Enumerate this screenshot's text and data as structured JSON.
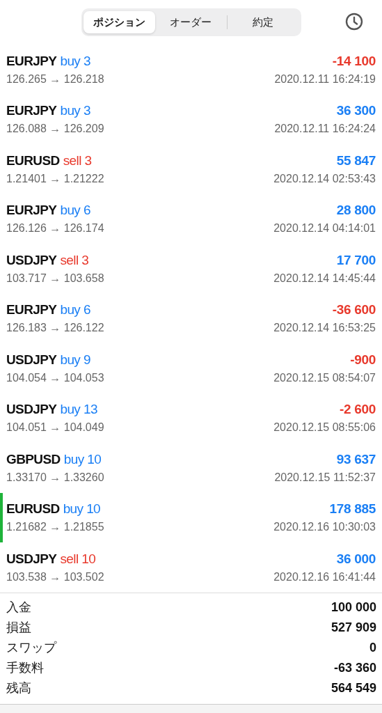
{
  "tabs": [
    {
      "label": "ポジション",
      "selected": true
    },
    {
      "label": "オーダー",
      "selected": false
    },
    {
      "label": "約定",
      "selected": false
    }
  ],
  "positions": [
    {
      "symbol": "EURJPY",
      "order": {
        "text": "buy 3",
        "color": "#1a7ff5"
      },
      "profit": {
        "text": "-14 100",
        "color": "#e8392c"
      },
      "prices": "126.265 → 126.218",
      "time": "2020.12.11 16:24:19",
      "selected": false
    },
    {
      "symbol": "EURJPY",
      "order": {
        "text": "buy 3",
        "color": "#1a7ff5"
      },
      "profit": {
        "text": "36 300",
        "color": "#1a7ff5"
      },
      "prices": "126.088 → 126.209",
      "time": "2020.12.11 16:24:24",
      "selected": false
    },
    {
      "symbol": "EURUSD",
      "order": {
        "text": "sell 3",
        "color": "#e8392c"
      },
      "profit": {
        "text": "55 847",
        "color": "#1a7ff5"
      },
      "prices": "1.21401 → 1.21222",
      "time": "2020.12.14 02:53:43",
      "selected": false
    },
    {
      "symbol": "EURJPY",
      "order": {
        "text": "buy 6",
        "color": "#1a7ff5"
      },
      "profit": {
        "text": "28 800",
        "color": "#1a7ff5"
      },
      "prices": "126.126 → 126.174",
      "time": "2020.12.14 04:14:01",
      "selected": false
    },
    {
      "symbol": "USDJPY",
      "order": {
        "text": "sell 3",
        "color": "#e8392c"
      },
      "profit": {
        "text": "17 700",
        "color": "#1a7ff5"
      },
      "prices": "103.717 → 103.658",
      "time": "2020.12.14 14:45:44",
      "selected": false
    },
    {
      "symbol": "EURJPY",
      "order": {
        "text": "buy 6",
        "color": "#1a7ff5"
      },
      "profit": {
        "text": "-36 600",
        "color": "#e8392c"
      },
      "prices": "126.183 → 126.122",
      "time": "2020.12.14 16:53:25",
      "selected": false
    },
    {
      "symbol": "USDJPY",
      "order": {
        "text": "buy 9",
        "color": "#1a7ff5"
      },
      "profit": {
        "text": "-900",
        "color": "#e8392c"
      },
      "prices": "104.054 → 104.053",
      "time": "2020.12.15 08:54:07",
      "selected": false
    },
    {
      "symbol": "USDJPY",
      "order": {
        "text": "buy 13",
        "color": "#1a7ff5"
      },
      "profit": {
        "text": "-2 600",
        "color": "#e8392c"
      },
      "prices": "104.051 → 104.049",
      "time": "2020.12.15 08:55:06",
      "selected": false
    },
    {
      "symbol": "GBPUSD",
      "order": {
        "text": "buy 10",
        "color": "#1a7ff5"
      },
      "profit": {
        "text": "93 637",
        "color": "#1a7ff5"
      },
      "prices": "1.33170 → 1.33260",
      "time": "2020.12.15 11:52:37",
      "selected": false
    },
    {
      "symbol": "EURUSD",
      "order": {
        "text": "buy 10",
        "color": "#1a7ff5"
      },
      "profit": {
        "text": "178 885",
        "color": "#1a7ff5"
      },
      "prices": "1.21682 → 1.21855",
      "time": "2020.12.16 10:30:03",
      "selected": true
    },
    {
      "symbol": "USDJPY",
      "order": {
        "text": "sell 10",
        "color": "#e8392c"
      },
      "profit": {
        "text": "36 000",
        "color": "#1a7ff5"
      },
      "prices": "103.538 → 103.502",
      "time": "2020.12.16 16:41:44",
      "selected": false
    }
  ],
  "summary": [
    {
      "label": "入金",
      "value": "100 000"
    },
    {
      "label": "損益",
      "value": "527 909"
    },
    {
      "label": "スワップ",
      "value": "0"
    },
    {
      "label": "手数料",
      "value": "-63 360"
    },
    {
      "label": "残高",
      "value": "564 549"
    }
  ]
}
